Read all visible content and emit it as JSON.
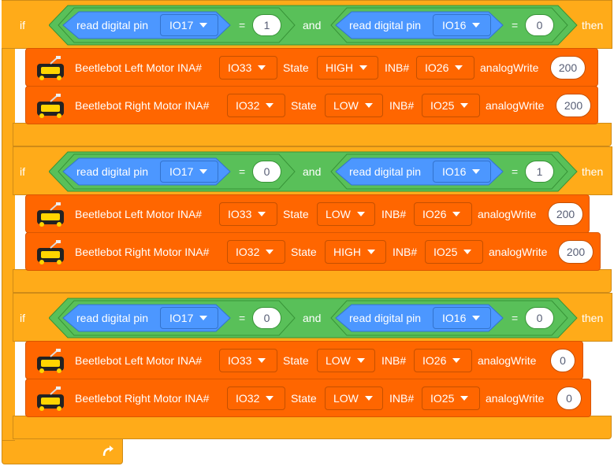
{
  "keywords": {
    "if": "if",
    "then": "then",
    "and": "and",
    "eq": "="
  },
  "labels": {
    "read_digital_pin": "read digital pin",
    "left_motor": "Beetlebot Left Motor INA#",
    "right_motor": "Beetlebot Right Motor INA#",
    "state": "State",
    "inb": "INB#",
    "analog_write": "analogWrite"
  },
  "conditions": [
    {
      "pin_a": "IO17",
      "value_a": "1",
      "pin_b": "IO16",
      "value_b": "0"
    },
    {
      "pin_a": "IO17",
      "value_a": "0",
      "pin_b": "IO16",
      "value_b": "1"
    },
    {
      "pin_a": "IO17",
      "value_a": "0",
      "pin_b": "IO16",
      "value_b": "0"
    }
  ],
  "motors": [
    [
      {
        "ina": "IO33",
        "state": "HIGH",
        "inb": "IO26",
        "value": "200"
      },
      {
        "ina": "IO32",
        "state": "LOW",
        "inb": "IO25",
        "value": "200"
      }
    ],
    [
      {
        "ina": "IO33",
        "state": "LOW",
        "inb": "IO26",
        "value": "200"
      },
      {
        "ina": "IO32",
        "state": "HIGH",
        "inb": "IO25",
        "value": "200"
      }
    ],
    [
      {
        "ina": "IO33",
        "state": "LOW",
        "inb": "IO26",
        "value": "0"
      },
      {
        "ina": "IO32",
        "state": "LOW",
        "inb": "IO25",
        "value": "0"
      }
    ]
  ],
  "colors": {
    "control": "#ffab19",
    "motor": "#ff6600",
    "operator": "#59c059",
    "sensing": "#4c97ff"
  },
  "icons": {
    "loop_end": "rotate-arrow-icon",
    "robot": "beetlebot-icon"
  }
}
